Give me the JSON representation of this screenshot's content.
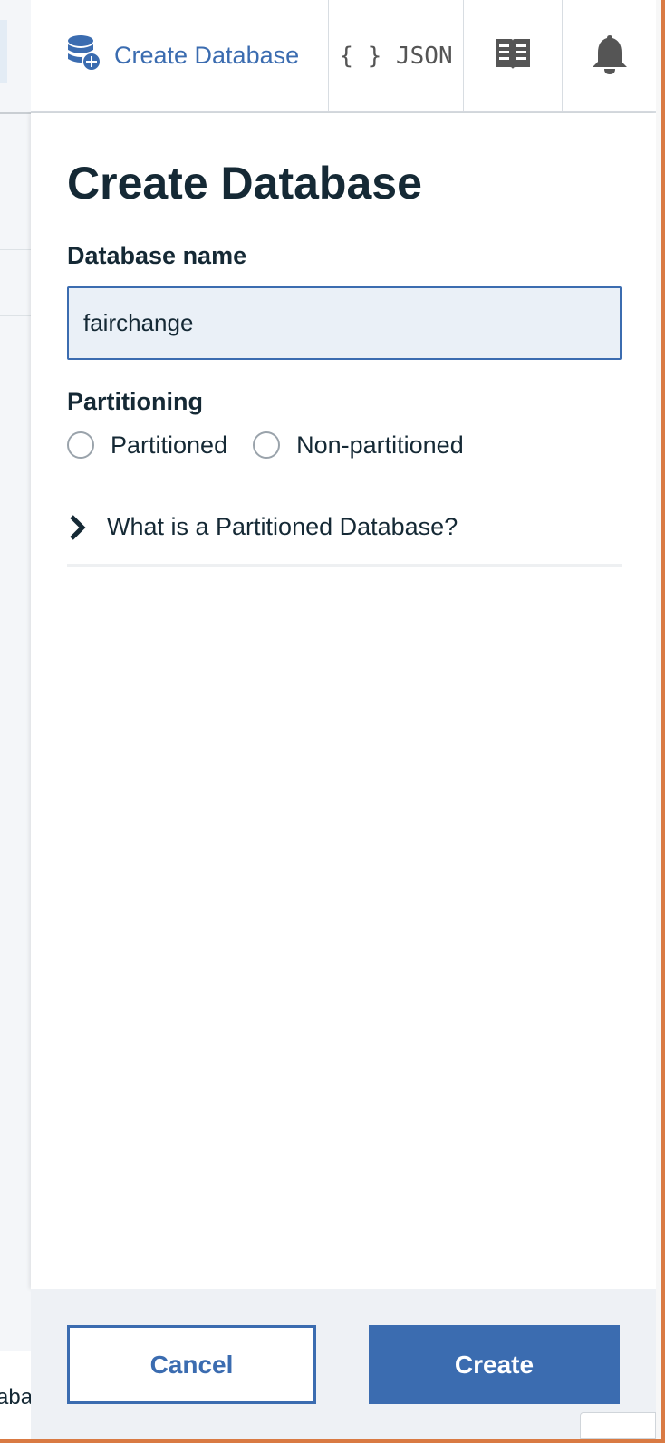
{
  "background": {
    "partial_text": "aba"
  },
  "header": {
    "create_database_label": "Create Database",
    "json_label": "{ } JSON"
  },
  "panel": {
    "title": "Create Database",
    "database_name_label": "Database name",
    "database_name_value": "fairchange",
    "partitioning_label": "Partitioning",
    "radio_options": [
      {
        "label": "Partitioned",
        "selected": false
      },
      {
        "label": "Non-partitioned",
        "selected": false
      }
    ],
    "accordion_label": "What is a Partitioned Database?"
  },
  "footer": {
    "cancel_label": "Cancel",
    "create_label": "Create"
  },
  "colors": {
    "accent": "#3b6cb0",
    "text": "#152935",
    "window_border": "#d97a43"
  },
  "icons": [
    "database-add-icon",
    "book-icon",
    "bell-icon",
    "chevron-right-icon"
  ]
}
